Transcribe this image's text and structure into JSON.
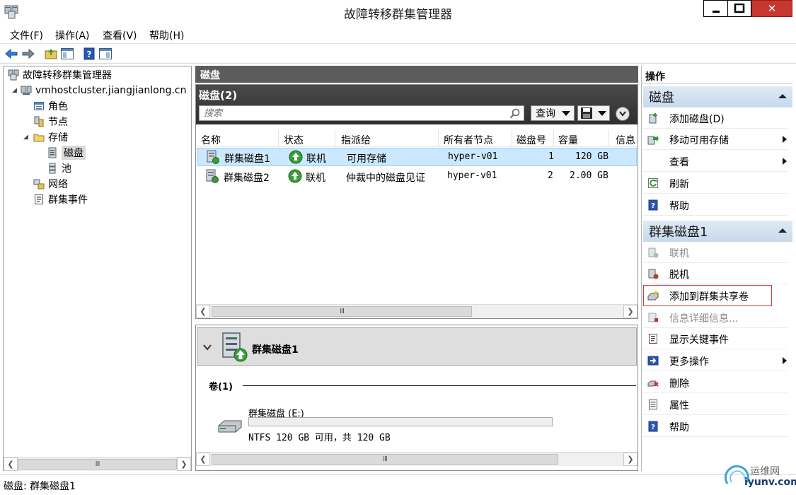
{
  "window": {
    "title": "故障转移群集管理器",
    "close_glyph": "✕"
  },
  "menu": [
    {
      "label": "文件(F)"
    },
    {
      "label": "操作(A)"
    },
    {
      "label": "查看(V)"
    },
    {
      "label": "帮助(H)"
    }
  ],
  "tree": {
    "root": "故障转移群集管理器",
    "cluster": "vmhostcluster.jiangjianlong.cn",
    "items": [
      {
        "label": "角色",
        "icon": "roles-icon"
      },
      {
        "label": "节点",
        "icon": "nodes-icon"
      },
      {
        "label": "存储",
        "icon": "storage-folder-icon"
      },
      {
        "label": "磁盘",
        "icon": "disk-icon"
      },
      {
        "label": "池",
        "icon": "pool-icon"
      },
      {
        "label": "网络",
        "icon": "network-icon"
      },
      {
        "label": "群集事件",
        "icon": "events-icon"
      }
    ],
    "scroll_glyph": "III"
  },
  "center": {
    "header": "磁盘",
    "panel_title": "磁盘(2)",
    "search_placeholder": "搜索",
    "query_label": "查询",
    "columns": [
      "名称",
      "状态",
      "指派给",
      "所有者节点",
      "磁盘号",
      "容量",
      "信息"
    ],
    "rows": [
      {
        "name": "群集磁盘1",
        "status": "联机",
        "assigned": "可用存储",
        "owner": "hyper-v01",
        "disk_no": "1",
        "capacity": "120 GB"
      },
      {
        "name": "群集磁盘2",
        "status": "联机",
        "assigned": "仲裁中的磁盘见证",
        "owner": "hyper-v01",
        "disk_no": "2",
        "capacity": "2.00 GB"
      }
    ],
    "scroll_glyph": "III"
  },
  "details": {
    "title": "群集磁盘1",
    "volumes_header": "卷(1)",
    "volume_name": "群集磁盘 (E:)",
    "volume_info": "NTFS 120 GB 可用，共 120 GB",
    "used_fraction": 0.0,
    "scroll_glyph": "III"
  },
  "actions": {
    "header": "操作",
    "sections": [
      {
        "title": "磁盘",
        "items": [
          {
            "label": "添加磁盘(D)",
            "icon": "add-disk-icon"
          },
          {
            "label": "移动可用存储",
            "icon": "move-storage-icon",
            "submenu": true
          },
          {
            "label": "查看",
            "icon": "",
            "submenu": true
          },
          {
            "label": "刷新",
            "icon": "refresh-icon"
          },
          {
            "label": "帮助",
            "icon": "help-icon"
          }
        ]
      },
      {
        "title": "群集磁盘1",
        "items": [
          {
            "label": "联机",
            "icon": "online-icon",
            "disabled": true
          },
          {
            "label": "脱机",
            "icon": "offline-icon"
          },
          {
            "label": "添加到群集共享卷",
            "icon": "add-csv-icon"
          },
          {
            "label": "信息详细信息...",
            "icon": "info-details-icon",
            "disabled": true
          },
          {
            "label": "显示关键事件",
            "icon": "critical-events-icon"
          },
          {
            "label": "更多操作",
            "icon": "more-actions-icon",
            "submenu": true
          },
          {
            "label": "删除",
            "icon": "delete-icon"
          },
          {
            "label": "属性",
            "icon": "properties-icon"
          },
          {
            "label": "帮助",
            "icon": "help-icon"
          }
        ]
      }
    ]
  },
  "status": {
    "text": "磁盘: 群集磁盘1"
  },
  "watermark": {
    "cn": "运维网",
    "url": "iyunv.com"
  },
  "colors": {
    "accent": "#26a0da",
    "selection": "#cce8ff",
    "close": "#c7372f",
    "dark_header": "#5c5c5c"
  }
}
